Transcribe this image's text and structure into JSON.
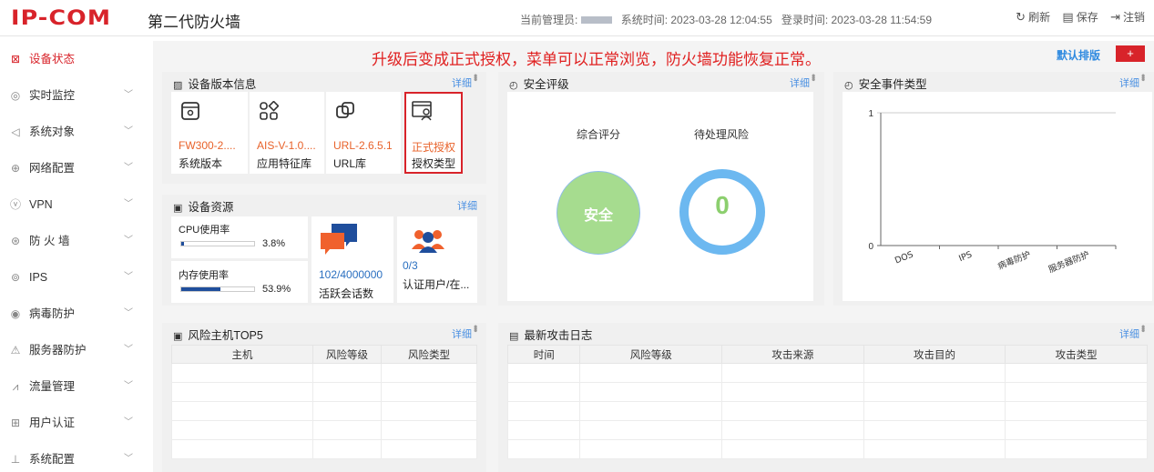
{
  "header": {
    "logo": "IP-COM",
    "product": "第二代防火墙",
    "admin_label": "当前管理员:",
    "system_time": "系统时间: 2023-03-28 12:04:55",
    "login_time": "登录时间: 2023-03-28 11:54:59",
    "refresh": "刷新",
    "save": "保存",
    "logout": "注销"
  },
  "sidebar": {
    "items": [
      {
        "label": "设备状态",
        "icon": "dashboard-icon"
      },
      {
        "label": "实时监控",
        "icon": "location-icon"
      },
      {
        "label": "系统对象",
        "icon": "send-icon"
      },
      {
        "label": "网络配置",
        "icon": "globe-icon"
      },
      {
        "label": "VPN",
        "icon": "vpn-icon"
      },
      {
        "label": "防 火 墙",
        "icon": "firewall-icon"
      },
      {
        "label": "IPS",
        "icon": "ips-icon"
      },
      {
        "label": "病毒防护",
        "icon": "virus-icon"
      },
      {
        "label": "服务器防护",
        "icon": "warning-icon"
      },
      {
        "label": "流量管理",
        "icon": "chart-icon"
      },
      {
        "label": "用户认证",
        "icon": "user-auth-icon"
      },
      {
        "label": "系统配置",
        "icon": "tree-icon"
      }
    ]
  },
  "main": {
    "notice": "升级后变成正式授权，菜单可以正常浏览，防火墙功能恢复正常。",
    "default_sort": "默认排版",
    "add": "+",
    "version": {
      "title": "设备版本信息",
      "detail": "详细",
      "tiles": [
        {
          "value": "FW300-2....",
          "label": "系统版本"
        },
        {
          "value": "AIS-V-1.0....",
          "label": "应用特征库"
        },
        {
          "value": "URL-2.6.5.1",
          "label": "URL库"
        },
        {
          "value": "正式授权",
          "label": "授权类型"
        }
      ]
    },
    "resource": {
      "title": "设备资源",
      "detail": "详细",
      "cpu_label": "CPU使用率",
      "cpu_value": "3.8%",
      "cpu_fraction": 0.038,
      "mem_label": "内存使用率",
      "mem_value": "53.9%",
      "mem_fraction": 0.539,
      "sessions_value": "102/4000000",
      "sessions_label": "活跃会话数",
      "users_value": "0/3",
      "users_label": "认证用户/在..."
    },
    "security": {
      "title": "安全评级",
      "detail": "详细",
      "score_label": "综合评分",
      "risk_label": "待处理风险",
      "score_value": "安全",
      "risk_value": "0"
    },
    "events": {
      "title": "安全事件类型",
      "detail": "详细"
    },
    "hosts": {
      "title": "风险主机TOP5",
      "detail": "详细",
      "columns": [
        "主机",
        "风险等级",
        "风险类型"
      ]
    },
    "logs": {
      "title": "最新攻击日志",
      "detail": "详细",
      "columns": [
        "时间",
        "风险等级",
        "攻击来源",
        "攻击目的",
        "攻击类型"
      ]
    }
  },
  "chart_data": {
    "type": "bar",
    "categories": [
      "DOS",
      "IPS",
      "病毒防护",
      "服务器防护"
    ],
    "values": [
      0,
      0,
      0,
      0
    ],
    "y_ticks": [
      "0",
      "1"
    ],
    "ylim": [
      0,
      1
    ],
    "grid": true
  },
  "colors": {
    "brand": "#d8232a",
    "accent": "#4a90e2",
    "safe_green": "#a6dc8f",
    "risk_blue": "#6cb8f0"
  }
}
